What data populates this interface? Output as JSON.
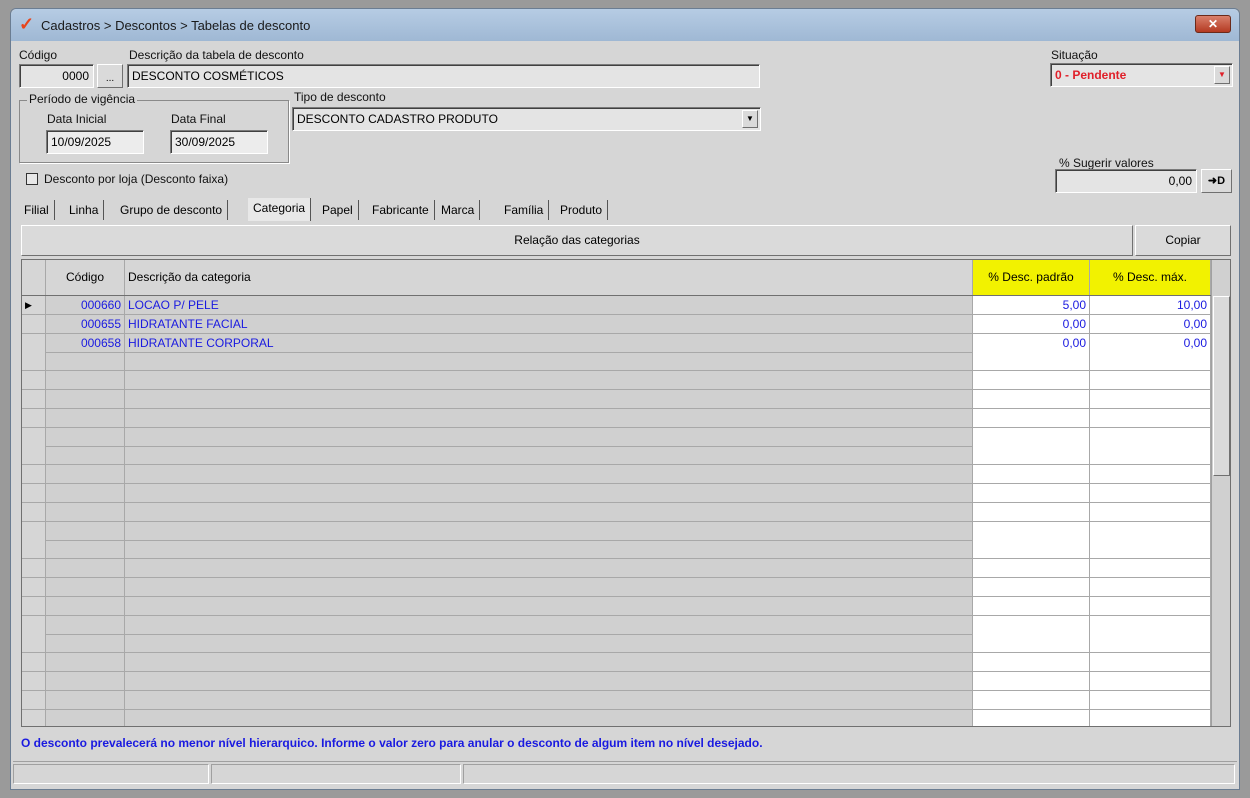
{
  "window": {
    "title": "Cadastros > Descontos > Tabelas de desconto",
    "close_label": "✕"
  },
  "form": {
    "codigo_label": "Código",
    "codigo_value": "0000",
    "lookup_label": "...",
    "descricao_label": "Descrição da tabela de desconto",
    "descricao_value": "DESCONTO COSMÉTICOS",
    "situacao_label": "Situação",
    "situacao_value": "0 - Pendente",
    "periodo_label": "Período de vigência",
    "data_inicial_label": "Data Inicial",
    "data_inicial_value": "10/09/2025",
    "data_final_label": "Data Final",
    "data_final_value": "30/09/2025",
    "tipo_label": "Tipo de desconto",
    "tipo_value": "DESCONTO CADASTRO PRODUTO",
    "desconto_loja_label": "Desconto por loja (Desconto faixa)",
    "sugerir_label": "% Sugerir valores",
    "sugerir_value": "0,00",
    "apply_label": "➜D"
  },
  "tabs": [
    "Filial",
    "Linha",
    "Grupo de desconto",
    "Categoria",
    "Papel",
    "Fabricante",
    "Marca",
    "Família",
    "Produto"
  ],
  "active_tab": "Categoria",
  "panel": {
    "title": "Relação das categorias",
    "copy_label": "Copiar"
  },
  "table": {
    "headers": [
      "Código",
      "Descrição da categoria",
      "% Desc. padrão",
      "% Desc. máx."
    ],
    "rows": [
      [
        "000660",
        "LOCAO P/ PELE",
        "5,00",
        "10,00"
      ],
      [
        "000655",
        "HIDRATANTE FACIAL",
        "0,00",
        "0,00"
      ],
      [
        "000658",
        "HIDRATANTE CORPORAL",
        "0,00",
        "0,00"
      ]
    ]
  },
  "footer_note": "O desconto prevalecerá no menor nível hierarquico. Informe o valor zero para anular o desconto de algum item no nível desejado.",
  "colors": {
    "header_highlight": "#f2f200",
    "value_blue": "#1a1ae0",
    "status_red": "#e0202a"
  }
}
